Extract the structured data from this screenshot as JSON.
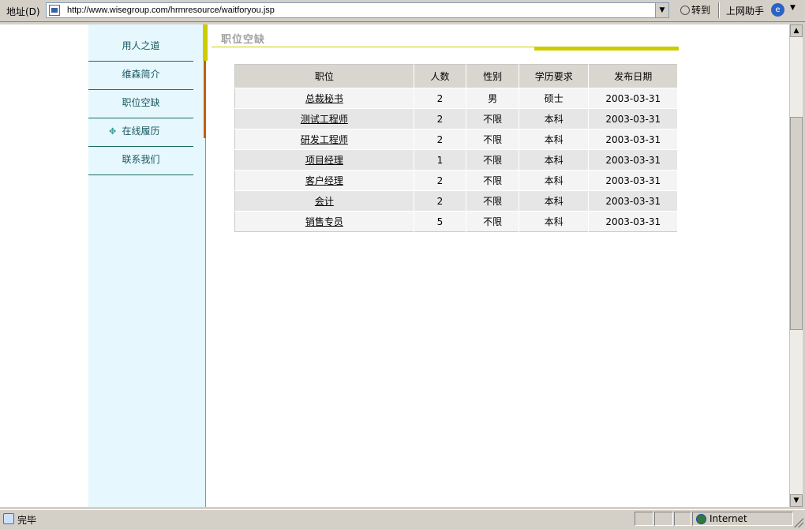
{
  "address_bar": {
    "label": "地址(D)",
    "url": "http://www.wisegroup.com/hrmresource/waitforyou.jsp",
    "go_label": "转到",
    "assistant_label": "上网助手"
  },
  "sidebar": {
    "items": [
      {
        "label": "用人之道"
      },
      {
        "label": "维森简介"
      },
      {
        "label": "职位空缺"
      },
      {
        "label": "在线履历"
      },
      {
        "label": "联系我们"
      }
    ]
  },
  "section": {
    "title": "职位空缺"
  },
  "table": {
    "headers": [
      "职位",
      "人数",
      "性别",
      "学历要求",
      "发布日期"
    ],
    "rows": [
      {
        "position": "总裁秘书",
        "count": "2",
        "gender": "男",
        "education": "硕士",
        "date": "2003-03-31"
      },
      {
        "position": "测试工程师",
        "count": "2",
        "gender": "不限",
        "education": "本科",
        "date": "2003-03-31"
      },
      {
        "position": "研发工程师",
        "count": "2",
        "gender": "不限",
        "education": "本科",
        "date": "2003-03-31"
      },
      {
        "position": "项目经理",
        "count": "1",
        "gender": "不限",
        "education": "本科",
        "date": "2003-03-31"
      },
      {
        "position": "客户经理",
        "count": "2",
        "gender": "不限",
        "education": "本科",
        "date": "2003-03-31"
      },
      {
        "position": "会计",
        "count": "2",
        "gender": "不限",
        "education": "本科",
        "date": "2003-03-31"
      },
      {
        "position": "销售专员",
        "count": "5",
        "gender": "不限",
        "education": "本科",
        "date": "2003-03-31"
      }
    ]
  },
  "status_bar": {
    "status_text": "完毕",
    "zone_label": "Internet"
  },
  "icons": {
    "page": "page-icon",
    "go": "go-arrow-icon",
    "assistant": "assistant-icon",
    "bullet": "diamond-bullet-icon",
    "zone": "globe-icon"
  }
}
